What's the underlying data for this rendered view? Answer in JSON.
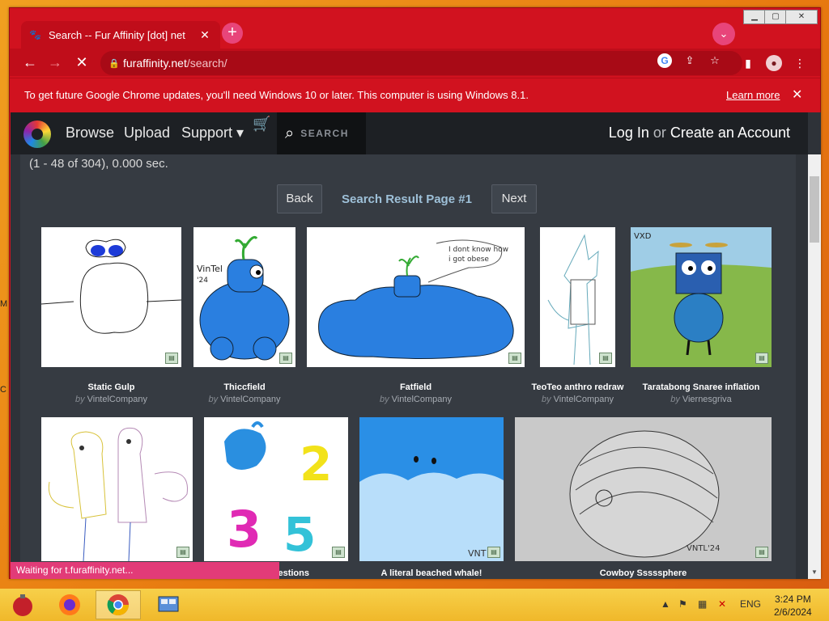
{
  "browser": {
    "tab_title": "Search -- Fur Affinity [dot] net",
    "tab_close": "✕",
    "new_tab": "+",
    "url_host": "furaffinity.net",
    "url_path": "/search/",
    "infobar_text": "To get future Google Chrome updates, you'll need Windows 10 or later. This computer is using Windows 8.1.",
    "infobar_link": "Learn more",
    "infobar_close": "✕",
    "status_text": "Waiting for t.furaffinity.net...",
    "accent": "#d1121f"
  },
  "site": {
    "nav": {
      "browse": "Browse",
      "upload": "Upload",
      "support": "Support ▾"
    },
    "search_placeholder": "SEARCH",
    "login": "Log In",
    "or": "or",
    "create_account": "Create an Account"
  },
  "search": {
    "stats": "(1 - 48 of 304), 0.000 sec.",
    "back_label": "Back",
    "next_label": "Next",
    "page_label": "Search Result Page #1"
  },
  "results": [
    {
      "title": "Static Gulp",
      "by": "by",
      "author": "VintelCompany"
    },
    {
      "title": "Thiccfield",
      "by": "by",
      "author": "VintelCompany"
    },
    {
      "title": "Fatfield",
      "by": "by",
      "author": "VintelCompany"
    },
    {
      "title": "TeoTeo anthro redraw",
      "by": "by",
      "author": "VintelCompany"
    },
    {
      "title": "Taratabong Snaree inflation",
      "by": "by",
      "author": "Viernesgriva"
    },
    {
      "title": "",
      "by": "",
      "author": ""
    },
    {
      "title": "...estions",
      "by": "",
      "author": ""
    },
    {
      "title": "A literal beached whale!",
      "by": "",
      "author": ""
    },
    {
      "title": "Cowboy Sssssphere",
      "by": "",
      "author": ""
    }
  ],
  "taskbar": {
    "lang": "ENG",
    "time": "3:24 PM",
    "date": "2/6/2024"
  }
}
